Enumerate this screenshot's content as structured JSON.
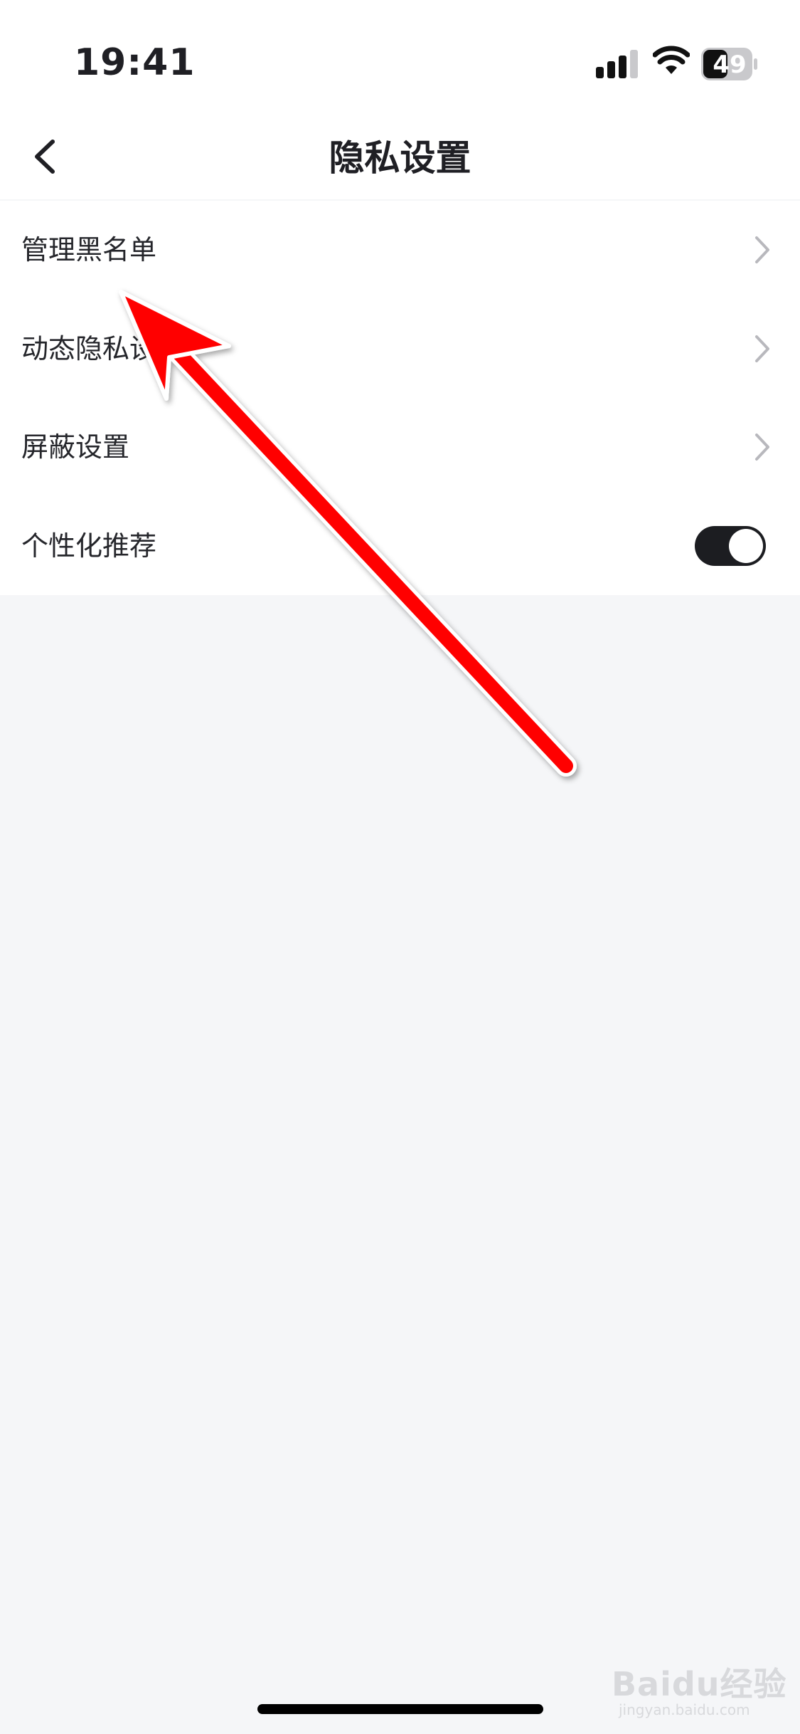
{
  "status_bar": {
    "time": "19:41",
    "battery": "49",
    "icons": [
      "signal-icon",
      "wifi-icon",
      "battery-icon"
    ]
  },
  "nav": {
    "title": "隐私设置",
    "back_icon": "chevron-left-icon"
  },
  "settings": {
    "items": [
      {
        "label": "管理黑名单",
        "type": "link"
      },
      {
        "label": "动态隐私设置",
        "type": "link"
      },
      {
        "label": "屏蔽设置",
        "type": "link"
      },
      {
        "label": "个性化推荐",
        "type": "toggle",
        "on": true
      }
    ]
  },
  "annotation": {
    "arrow_color": "#ff0000",
    "target": "管理黑名单"
  },
  "watermark": {
    "brand": "Baidu经验",
    "sub": "jingyan.baidu.com"
  },
  "colors": {
    "toggle_on": "#1c1d21",
    "page_background": "#f5f6f8",
    "card_background": "#ffffff"
  }
}
